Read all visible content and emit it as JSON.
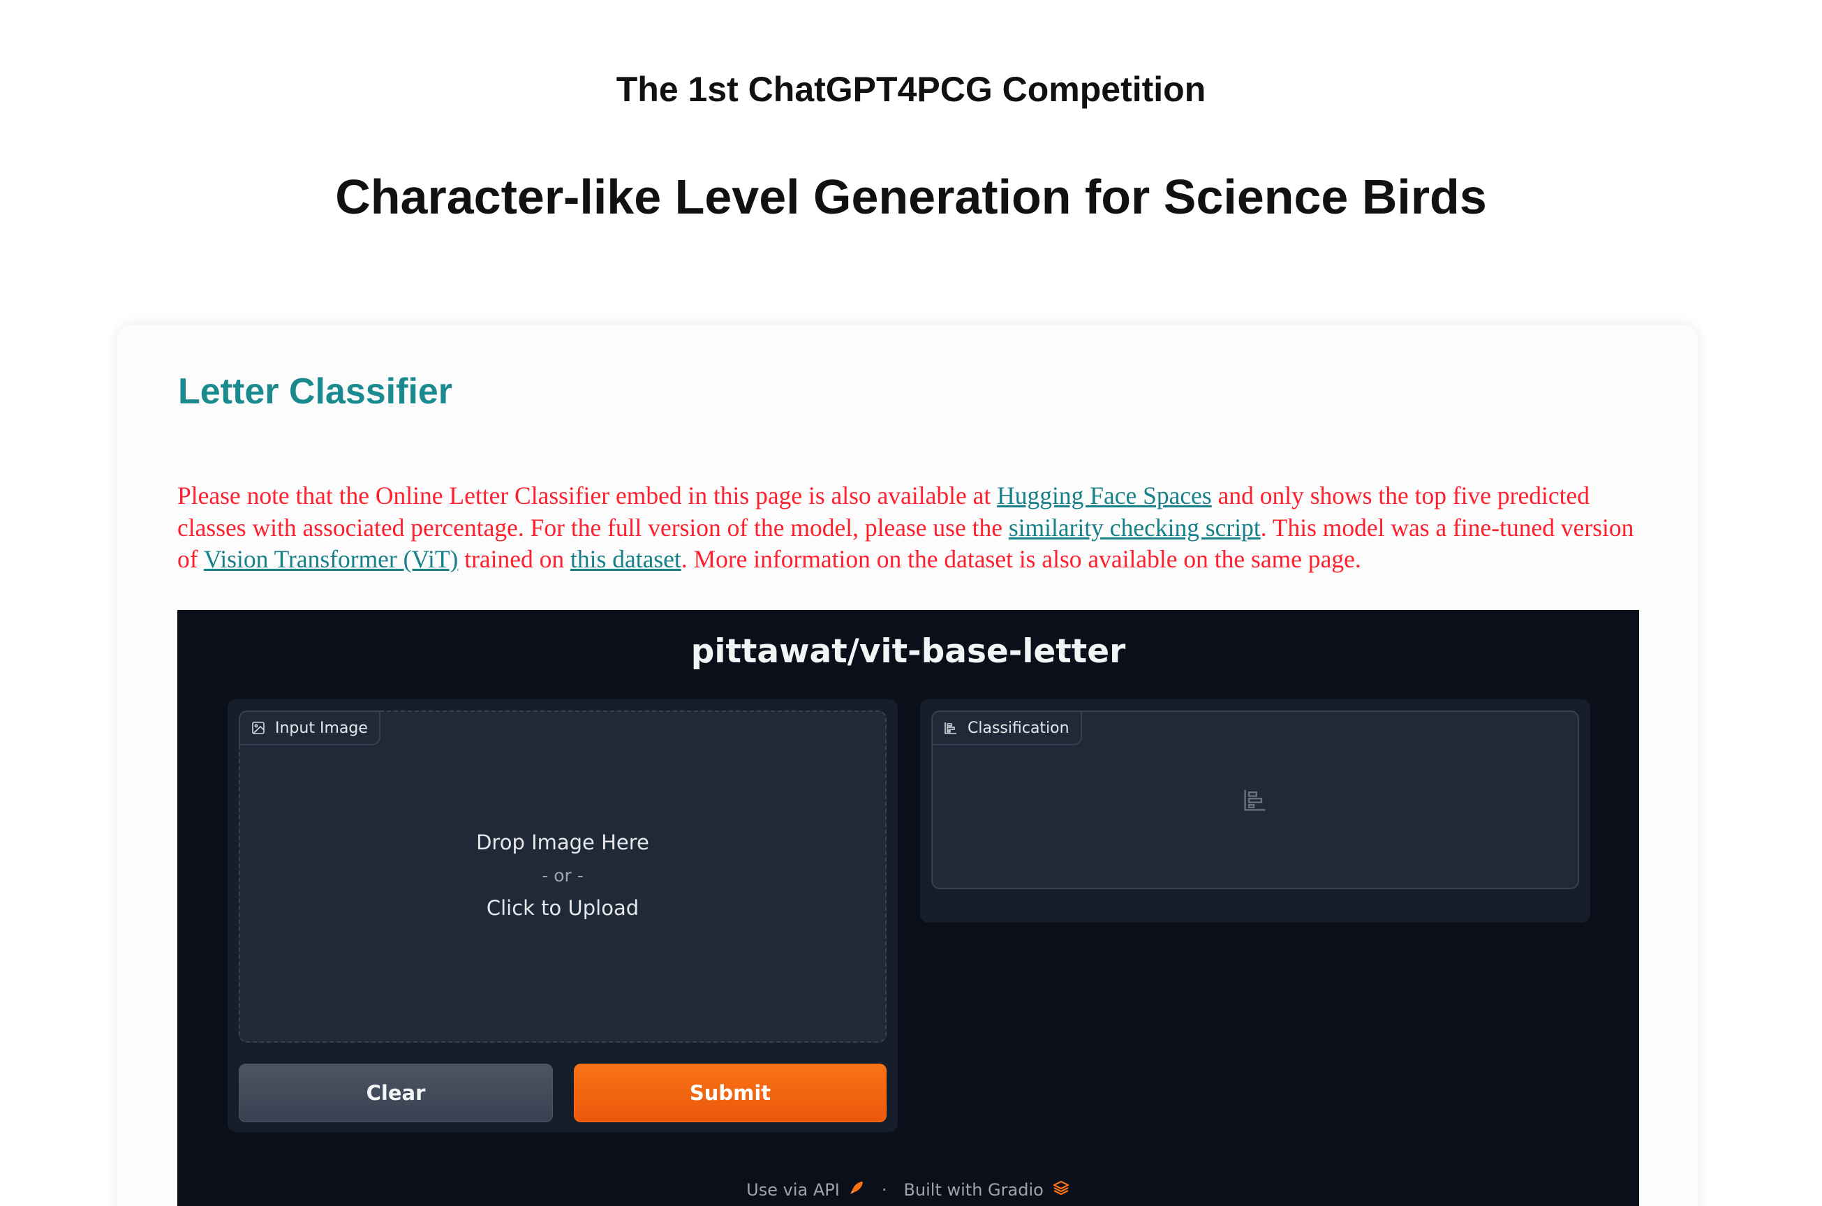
{
  "header": {
    "competition_title": "The 1st ChatGPT4PCG Competition",
    "main_title": "Character-like Level Generation for Science Birds"
  },
  "section": {
    "heading": "Letter Classifier",
    "note": {
      "part1": "Please note that the Online Letter Classifier embed in this page is also available at ",
      "link1": "Hugging Face Spaces",
      "part2": " and only shows the top five predicted classes with associated percentage. For the full version of the model, please use the ",
      "link2": "similarity checking script",
      "part3": ". This model was a fine-tuned version of ",
      "link3": "Vision Transformer (ViT)",
      "part4": " trained on ",
      "link4": "this dataset",
      "part5": ". More information on the dataset is also available on the same page."
    }
  },
  "app": {
    "title": "pittawat/vit-base-letter",
    "input_label": "Input Image",
    "drop_text": "Drop Image Here",
    "or_text": "- or -",
    "click_text": "Click to Upload",
    "output_label": "Classification",
    "clear_label": "Clear",
    "submit_label": "Submit",
    "footer_api": "Use via API",
    "footer_separator": "·",
    "footer_built": "Built with Gradio"
  },
  "icons": {
    "input_label_icon": "image-icon",
    "output_label_icon": "bar-chart-icon",
    "empty_output_icon": "bar-chart-icon",
    "api_icon": "rocket-icon",
    "gradio_icon": "gradio-logo-icon"
  },
  "colors": {
    "heading_teal": "#1b8a8f",
    "note_red": "#ff1f2d",
    "link_teal": "#178189",
    "app_bg": "#0b0f19",
    "submit_orange": "#f97316",
    "clear_gray": "#4b5563"
  }
}
